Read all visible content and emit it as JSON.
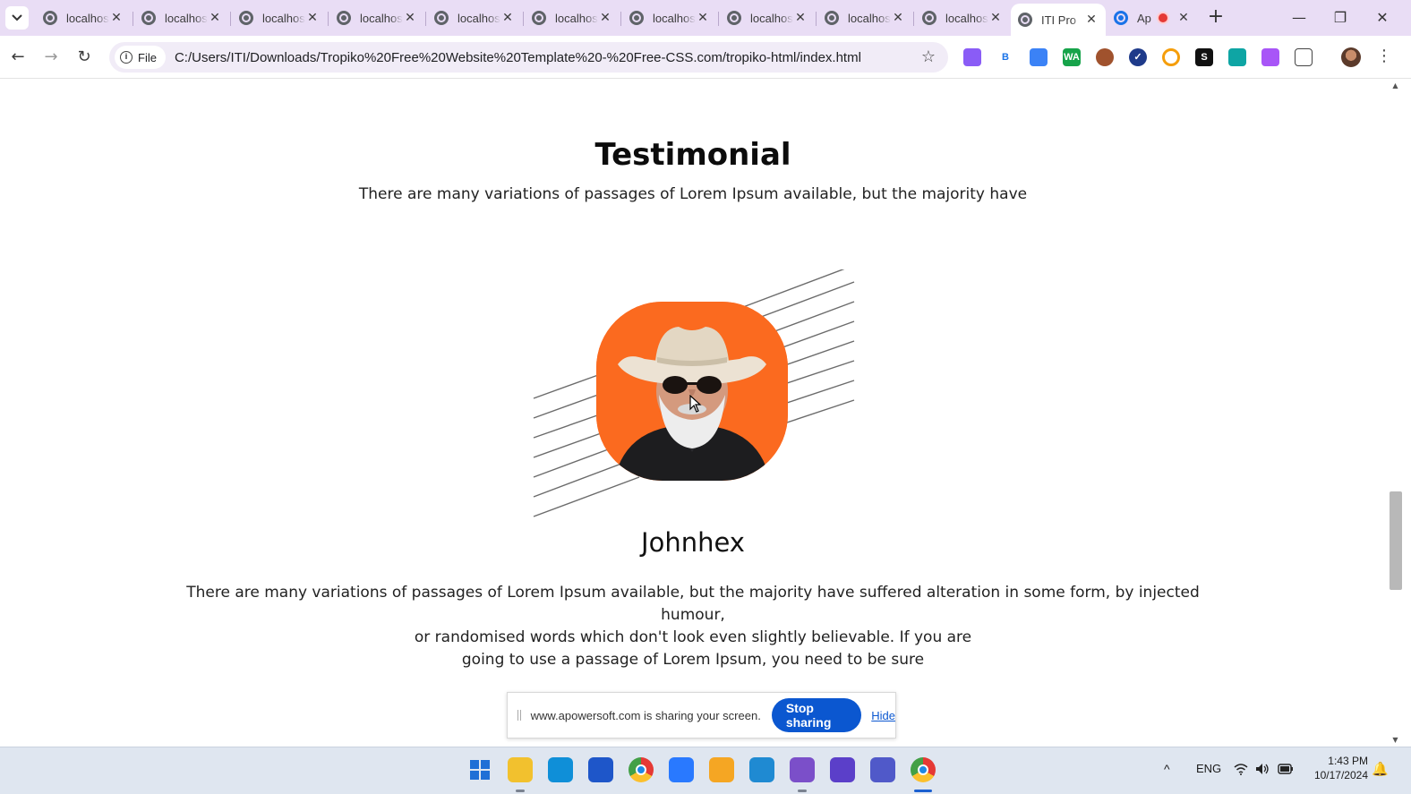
{
  "browser": {
    "tabs": [
      {
        "label": "localhost"
      },
      {
        "label": "localhost"
      },
      {
        "label": "localhost"
      },
      {
        "label": "localhost"
      },
      {
        "label": "localhost"
      },
      {
        "label": "localhost"
      },
      {
        "label": "localhost"
      },
      {
        "label": "localhost"
      },
      {
        "label": "localhost"
      },
      {
        "label": "localhost"
      },
      {
        "label": "ITI Pro",
        "active": true
      },
      {
        "label": "Ap",
        "recording": true
      }
    ],
    "new_tab": "+",
    "window_controls": {
      "minimize": "—",
      "restore": "❐",
      "close": "✕"
    },
    "toolbar": {
      "back": "←",
      "forward": "→",
      "reload": "↻",
      "site_chip": "File",
      "url": "C:/Users/ITI/Downloads/Tropiko%20Free%20Website%20Template%20-%20Free-CSS.com/tropiko-html/index.html",
      "bookmark_icon": "star-icon",
      "extensions": [
        {
          "icon": "gear-extension-icon",
          "color": "#8a5cf6",
          "text": ""
        },
        {
          "icon": "b-extension-icon",
          "color": "#ffffff",
          "text": "B"
        },
        {
          "icon": "feather-extension-icon",
          "color": "#3b82f6",
          "text": ""
        },
        {
          "icon": "wa-extension-icon",
          "color": "#16a34a",
          "text": "WA"
        },
        {
          "icon": "cookie-extension-icon",
          "color": "#a0522d",
          "text": ""
        },
        {
          "icon": "check-extension-icon",
          "color": "#1e3a8a",
          "text": "✓"
        },
        {
          "icon": "ring-extension-icon",
          "color": "#f59e0b",
          "text": ""
        },
        {
          "icon": "s-extension-icon",
          "color": "#111111",
          "text": "S"
        },
        {
          "icon": "translate-extension-icon",
          "color": "#0ea5a4",
          "text": ""
        },
        {
          "icon": "globe-extension-icon",
          "color": "#a855f7",
          "text": ""
        },
        {
          "icon": "puzzle-icon",
          "color": "#444444",
          "text": ""
        }
      ],
      "menu": "⋮"
    }
  },
  "page": {
    "heading": "Testimonial",
    "subheading": "There are many variations of passages of Lorem Ipsum available, but the majority have",
    "portrait_alt": "man with cowboy hat and sunglasses",
    "name": "Johnhex",
    "quote_lines": [
      "There are many variations of passages of Lorem Ipsum available, but the majority have suffered alteration in some form, by injected humour,",
      "or randomised words which don't look even slightly believable. If you are",
      "going to use a passage of Lorem Ipsum, you need to be sure"
    ],
    "scroll_position_fraction": 0.62
  },
  "share_banner": {
    "text": "www.apowersoft.com is sharing your screen.",
    "stop_label": "Stop sharing",
    "hide_label": "Hide"
  },
  "taskbar": {
    "apps": [
      {
        "name": "start-icon",
        "color": "#1f6fd6"
      },
      {
        "name": "file-explorer-icon",
        "color": "#f2c12e"
      },
      {
        "name": "edge-icon",
        "color": "#0f8fd8"
      },
      {
        "name": "store-icon",
        "color": "#1e56c9"
      },
      {
        "name": "chrome-icon",
        "color": "#e53935"
      },
      {
        "name": "app-icon",
        "color": "#2979ff"
      },
      {
        "name": "paint-icon",
        "color": "#f5a623"
      },
      {
        "name": "vscode-icon",
        "color": "#1f8ad2"
      },
      {
        "name": "visual-studio-icon",
        "color": "#7b4fc9"
      },
      {
        "name": "iptv-icon",
        "color": "#5b3fc9"
      },
      {
        "name": "teams-icon",
        "color": "#5059c9"
      },
      {
        "name": "chrome-active-icon",
        "color": "#e53935"
      }
    ],
    "tray": {
      "chevron": "^",
      "language": "ENG",
      "time": "1:43 PM",
      "date": "10/17/2024"
    }
  }
}
